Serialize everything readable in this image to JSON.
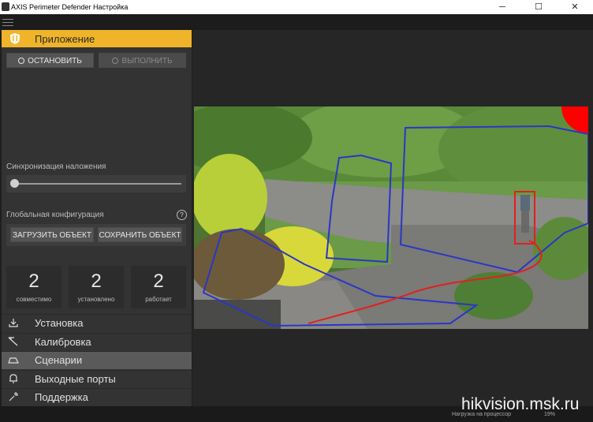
{
  "window": {
    "title": "AXIS Perimeter Defender Настройка",
    "minimize": "─",
    "maximize": "☐",
    "close": "✕"
  },
  "app": {
    "header": "Приложение"
  },
  "buttons": {
    "stop": "ОСТАНОВИТЬ",
    "run": "ВЫПОЛНИТЬ",
    "load": "ЗАГРУЗИТЬ ОБЪЕКТ",
    "save": "СОХРАНИТЬ ОБЪЕКТ"
  },
  "sync": {
    "label": "Синхронизация наложения",
    "level": 0.0
  },
  "global_config": {
    "label": "Глобальная конфигурация",
    "help": "?"
  },
  "stats": [
    {
      "value": "2",
      "label": "совместимо"
    },
    {
      "value": "2",
      "label": "установлено"
    },
    {
      "value": "2",
      "label": "работает"
    }
  ],
  "nav": [
    {
      "label": "Установка",
      "icon": "download-icon"
    },
    {
      "label": "Калибровка",
      "icon": "calibration-icon"
    },
    {
      "label": "Сценарии",
      "icon": "scenario-icon",
      "active": true
    },
    {
      "label": "Выходные порты",
      "icon": "bell-icon"
    },
    {
      "label": "Поддержка",
      "icon": "wrench-icon"
    }
  ],
  "status": {
    "cpu_label": "Нагрузка на процессор",
    "cpu_value": "19%"
  },
  "watermark": "hikvision.msk.ru",
  "colors": {
    "accent": "#f0b42a",
    "zone": "#2a36c8",
    "detection": "#e02020",
    "active_nav": "#5a5a5a"
  }
}
